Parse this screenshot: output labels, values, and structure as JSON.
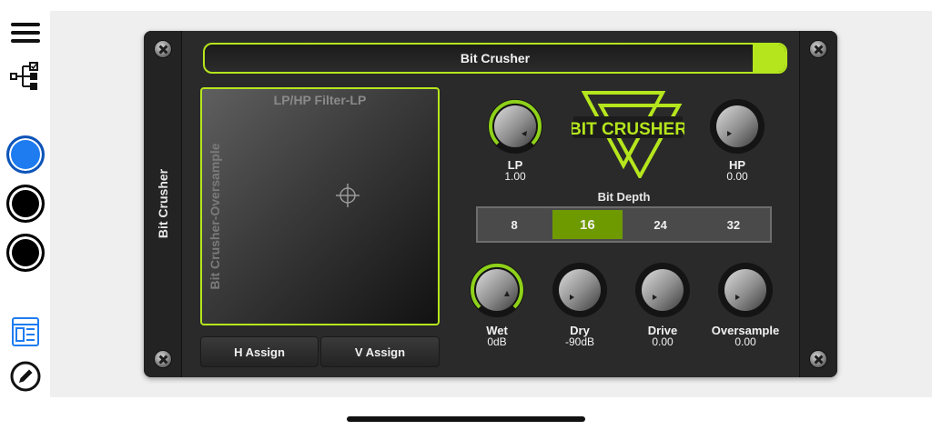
{
  "sidebar": {
    "items": [
      {
        "icon": "menu-icon"
      },
      {
        "icon": "tree-icon"
      },
      {
        "icon": "circle-blue",
        "color": "#1e7cf0"
      },
      {
        "icon": "circle-black",
        "color": "#000000"
      },
      {
        "icon": "circle-black",
        "color": "#000000"
      },
      {
        "icon": "layout-icon"
      },
      {
        "icon": "edit-icon"
      }
    ]
  },
  "device": {
    "name": "Bit Crusher",
    "side_title": "Bit Crusher",
    "accent": "#b5e61d",
    "logo": "BIT CRUSHER"
  },
  "xy_pad": {
    "top_label": "LP/HP Filter-LP",
    "left_label": "Bit Crusher-Oversample",
    "h_assign": "H Assign",
    "v_assign": "V Assign"
  },
  "knobs": {
    "lp": {
      "label": "LP",
      "value": "1.00"
    },
    "hp": {
      "label": "HP",
      "value": "0.00"
    },
    "wet": {
      "label": "Wet",
      "value": "0dB"
    },
    "dry": {
      "label": "Dry",
      "value": "-90dB"
    },
    "drive": {
      "label": "Drive",
      "value": "0.00"
    },
    "oversample": {
      "label": "Oversample",
      "value": "0.00"
    }
  },
  "bit_depth": {
    "label": "Bit Depth",
    "options": [
      "8",
      "16",
      "24",
      "32"
    ],
    "selected": "16"
  }
}
